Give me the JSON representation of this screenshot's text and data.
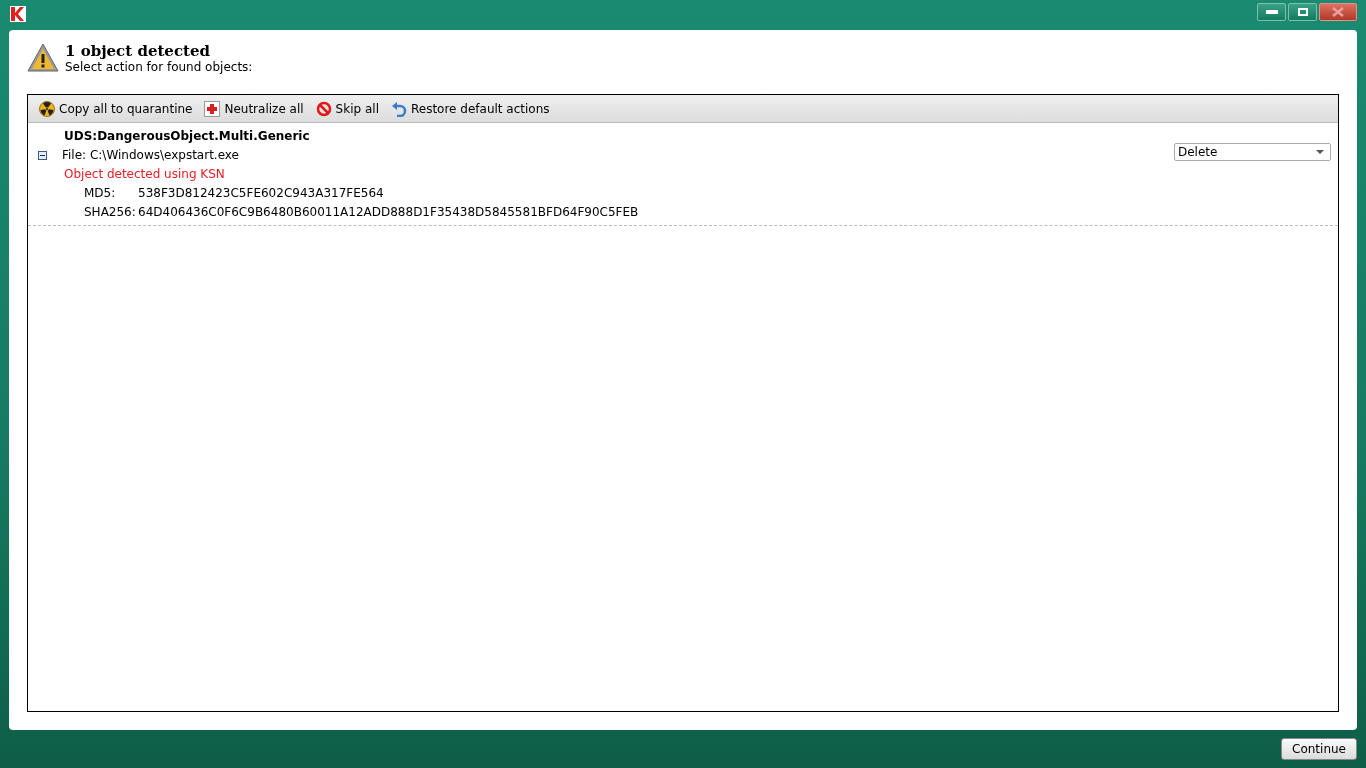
{
  "header": {
    "title": "1 object detected",
    "subtitle": "Select action for found objects:"
  },
  "toolbar": [
    {
      "kind": "quarantine",
      "label": "Copy all to quarantine"
    },
    {
      "kind": "neutralize",
      "label": "Neutralize all"
    },
    {
      "kind": "skip",
      "label": "Skip all"
    },
    {
      "kind": "restore",
      "label": "Restore default actions"
    }
  ],
  "objects": [
    {
      "name": "UDS:DangerousObject.Multi.Generic",
      "expanded": true,
      "file": "File: C:\\Windows\\expstart.exe",
      "note": "Object detected using KSN",
      "action": "Delete",
      "hashes": [
        {
          "label": "MD5:",
          "value": "538F3D812423C5FE602C943A317FE564"
        },
        {
          "label": "SHA256:",
          "value": "64D406436C0F6C9B6480B60011A12ADD888D1F35438D5845581BFD64F90C5FEB"
        }
      ]
    }
  ],
  "buttons": [
    "Continue"
  ]
}
